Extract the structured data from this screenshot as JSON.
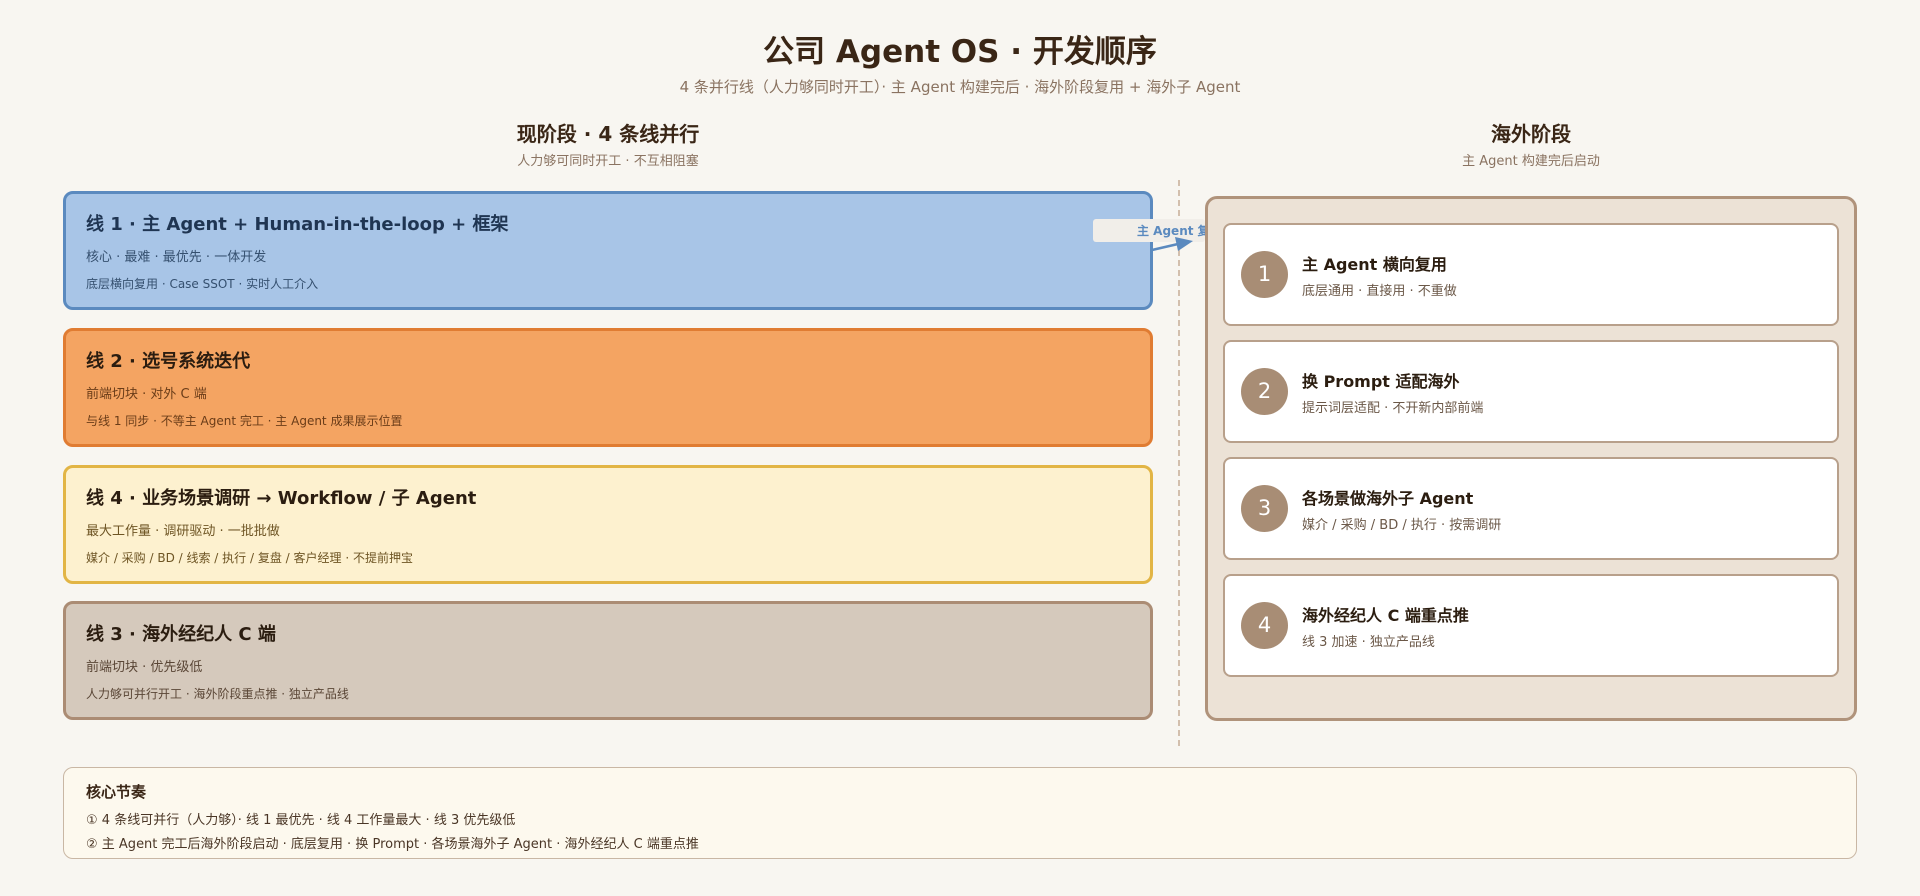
{
  "header": {
    "title": "公司 Agent OS · 开发顺序",
    "subtitle": "4 条并行线（人力够同时开工）· 主 Agent 构建完后 · 海外阶段复用 + 海外子 Agent"
  },
  "current_stage": {
    "title": "现阶段 · 4 条线并行",
    "subtitle": "人力够可同时开工 · 不互相阻塞"
  },
  "lines": [
    {
      "title": "线 1 · 主 Agent + Human-in-the-loop + 框架",
      "line2": "核心 · 最难 · 最优先 · 一体开发",
      "line3": "底层横向复用 · Case SSOT · 实时人工介入"
    },
    {
      "title": "线 2 · 选号系统迭代",
      "line2": "前端切块 · 对外 C 端",
      "line3": "与线 1 同步 · 不等主 Agent 完工 · 主 Agent 成果展示位置"
    },
    {
      "title": "线 4 · 业务场景调研 → Workflow / 子 Agent",
      "line2": "最大工作量 · 调研驱动 · 一批批做",
      "line3": "媒介 / 采购 / BD / 线索 / 执行 / 复盘 / 客户经理 · 不提前押宝"
    },
    {
      "title": "线 3 · 海外经纪人 C 端",
      "line2": "前端切块 · 优先级低",
      "line3": "人力够可并行开工 · 海外阶段重点推 · 独立产品线"
    }
  ],
  "arrow": {
    "label": "主 Agent 复用"
  },
  "overseas_stage": {
    "title": "海外阶段",
    "subtitle": "主 Agent 构建完后启动",
    "steps": [
      {
        "num": "1",
        "title": "主 Agent 横向复用",
        "sub": "底层通用 · 直接用 · 不重做"
      },
      {
        "num": "2",
        "title": "换 Prompt 适配海外",
        "sub": "提示词层适配 · 不开新内部前端"
      },
      {
        "num": "3",
        "title": "各场景做海外子 Agent",
        "sub": "媒介 / 采购 / BD / 执行 · 按需调研"
      },
      {
        "num": "4",
        "title": "海外经纪人 C 端重点推",
        "sub": "线 3 加速 · 独立产品线"
      }
    ]
  },
  "rhythm": {
    "title": "核心节奏",
    "line1": "① 4 条线可并行（人力够）· 线 1 最优先 · 线 4 工作量最大 · 线 3 优先级低",
    "line2": "② 主 Agent 完工后海外阶段启动 · 底层复用 · 换 Prompt · 各场景海外子 Agent · 海外经纪人 C 端重点推"
  },
  "colors": {
    "line1_fill": "#a8c5e7",
    "line2_fill": "#f4a462",
    "line4_fill": "#fdf1cf",
    "line3_fill": "#d5c9bc",
    "step_circle": "#a88d75",
    "arrow": "#5b8abf"
  }
}
